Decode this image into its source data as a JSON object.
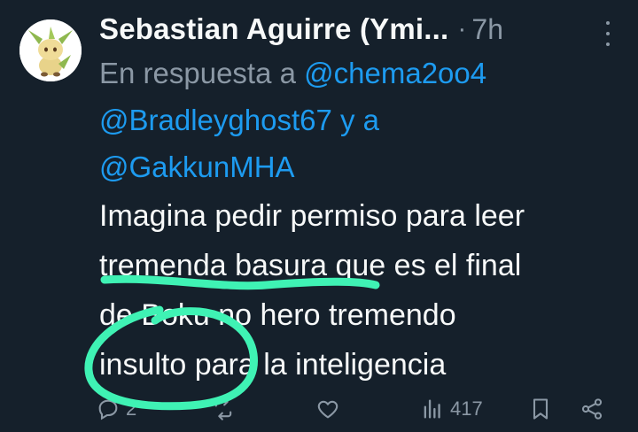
{
  "author": {
    "display_name": "Sebastian Aguirre (Ymi...",
    "separator": "·",
    "time": "7h",
    "avatar_icon": "leafeon-avatar-icon"
  },
  "reply_to": {
    "prefix": "En respuesta a",
    "mention_1": "@chema2oo4",
    "mention_2": "@Bradleyghost67",
    "connector": "y a",
    "mention_3": "@GakkunMHA"
  },
  "tweet_text": {
    "line_1": "Imagina pedir permiso para leer",
    "line_2a": "tremenda basura",
    "line_2b": " que es el final",
    "line_3": "de Boku no hero tremendo",
    "line_4a": "insulto pa",
    "line_4b": "ra la inteligencia"
  },
  "actions": {
    "reply_count": "2",
    "retweet_count": "",
    "like_count": "",
    "views_count": "417"
  },
  "colors": {
    "background": "#15202b",
    "text": "#f7f9f9",
    "secondary": "#8b98a5",
    "link": "#1d9bf0",
    "highlight_marker": "#3ff2b4"
  }
}
